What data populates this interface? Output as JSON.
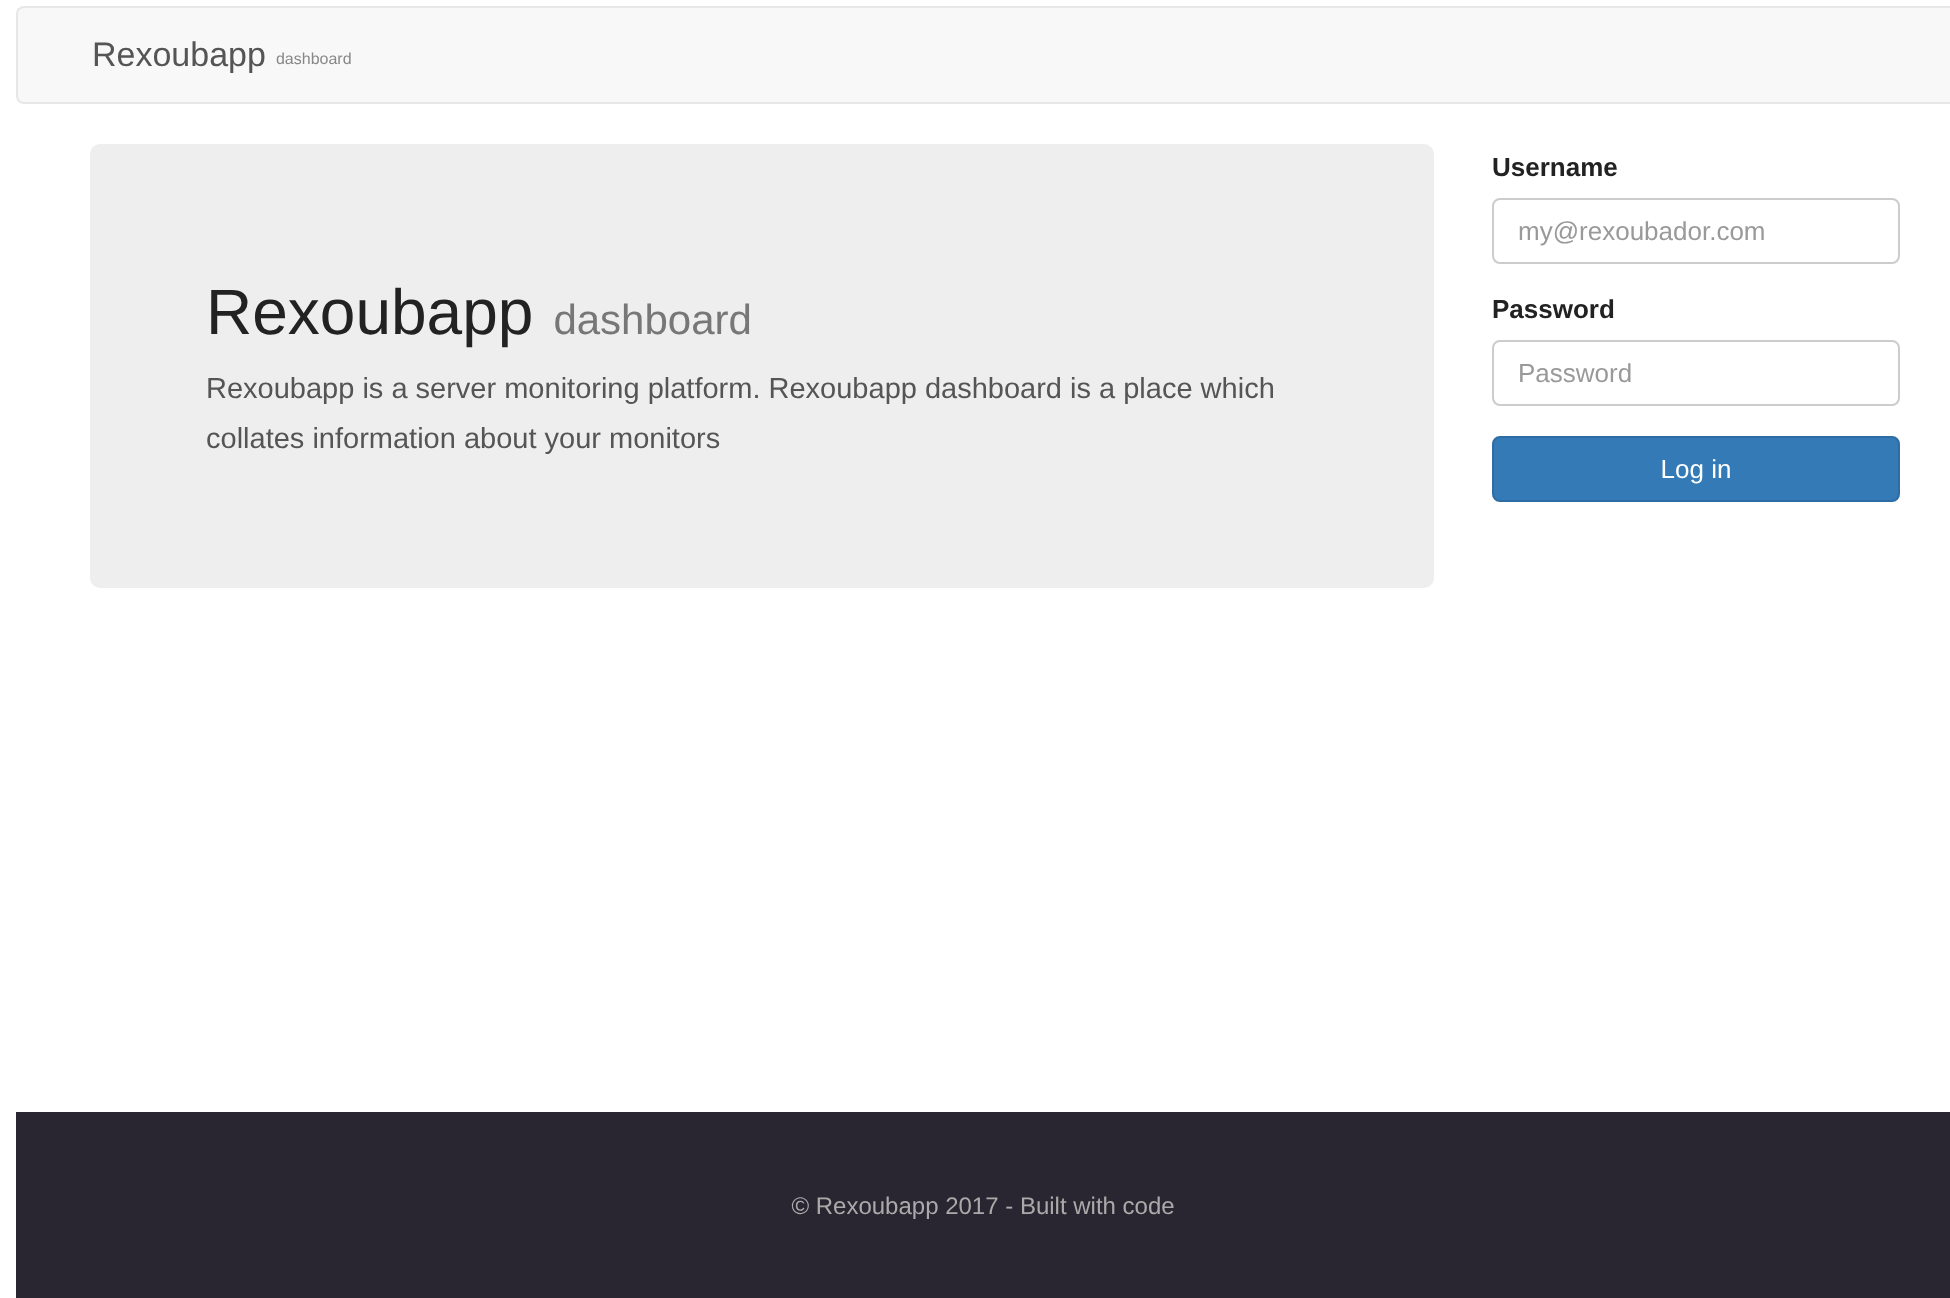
{
  "navbar": {
    "brand": "Rexoubapp",
    "brand_sub": "dashboard"
  },
  "hero": {
    "title": "Rexoubapp",
    "subtitle": "dashboard",
    "description": "Rexoubapp is a server monitoring platform. Rexoubapp dashboard is a place which collates information about your monitors"
  },
  "login": {
    "fields": [
      {
        "label": "Username",
        "placeholder": "my@rexoubador.com"
      },
      {
        "label": "Password",
        "placeholder": "Password"
      }
    ],
    "button": "Log in"
  },
  "footer": "© Rexoubapp 2017 - Built with code"
}
